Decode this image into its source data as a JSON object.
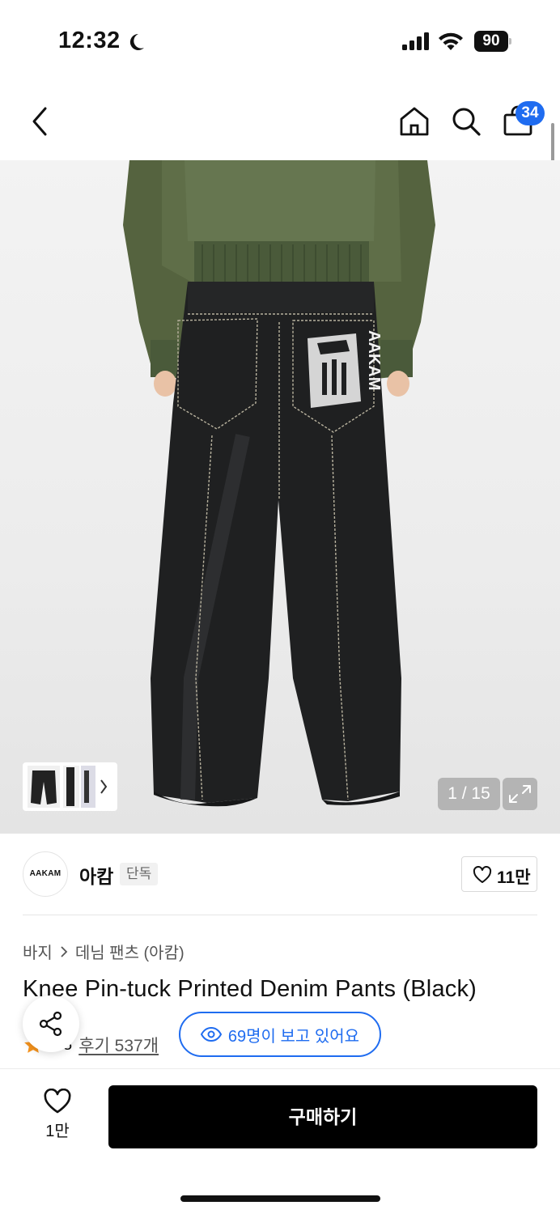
{
  "status_bar": {
    "time": "12:32",
    "battery": "90"
  },
  "nav": {
    "cart_count": "34"
  },
  "gallery": {
    "counter": "1 / 15",
    "print_text": "AAKAM"
  },
  "brand": {
    "logo_text": "AAKAM",
    "name": "아캄",
    "tag": "단독",
    "likes": "11만"
  },
  "breadcrumb": {
    "category": "바지",
    "subcategory": "데님 팬츠 (아캄)"
  },
  "product": {
    "title": "Knee Pin-tuck Printed Denim Pants (Black)",
    "rating": "4.8",
    "reviews": "후기 537개"
  },
  "viewers": {
    "text": "69명이 보고 있어요"
  },
  "bottom": {
    "wish_count": "1만",
    "buy_label": "구매하기"
  },
  "colors": {
    "accent": "#1f6cf0",
    "buy_button": "#000000",
    "star": "#f7941d"
  }
}
